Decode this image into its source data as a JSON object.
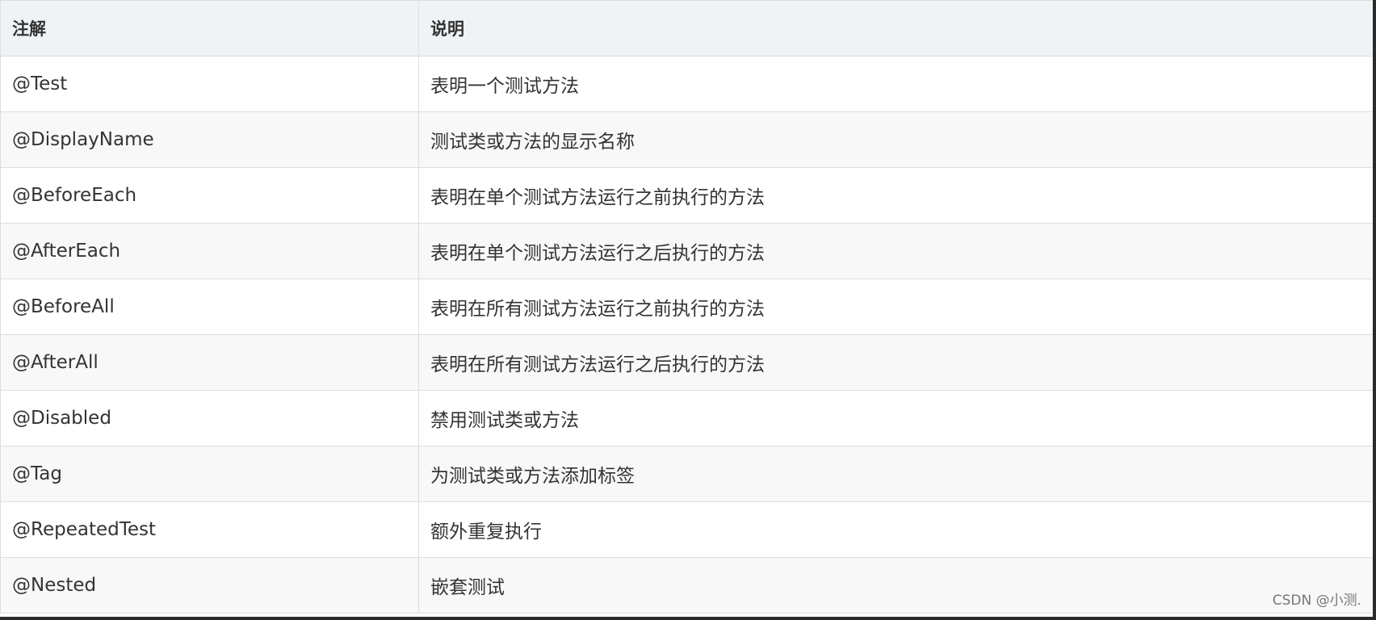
{
  "table": {
    "headers": [
      "注解",
      "说明"
    ],
    "rows": [
      [
        "@Test",
        "表明一个测试方法"
      ],
      [
        "@DisplayName",
        "测试类或方法的显示名称"
      ],
      [
        "@BeforeEach",
        "表明在单个测试方法运行之前执行的方法"
      ],
      [
        "@AfterEach",
        "表明在单个测试方法运行之后执行的方法"
      ],
      [
        "@BeforeAll",
        "表明在所有测试方法运行之前执行的方法"
      ],
      [
        "@AfterAll",
        "表明在所有测试方法运行之后执行的方法"
      ],
      [
        "@Disabled",
        "禁用测试类或方法"
      ],
      [
        "@Tag",
        "为测试类或方法添加标签"
      ],
      [
        "@RepeatedTest",
        "额外重复执行"
      ],
      [
        "@Nested",
        "嵌套测试"
      ]
    ]
  },
  "watermark": "CSDN @小测.",
  "colors": {
    "header_bg": "#eff3f5",
    "row_alt_bg": "#f8f8f8",
    "border": "#dddddd",
    "text": "#333333",
    "frame": "#2b2b2b"
  }
}
